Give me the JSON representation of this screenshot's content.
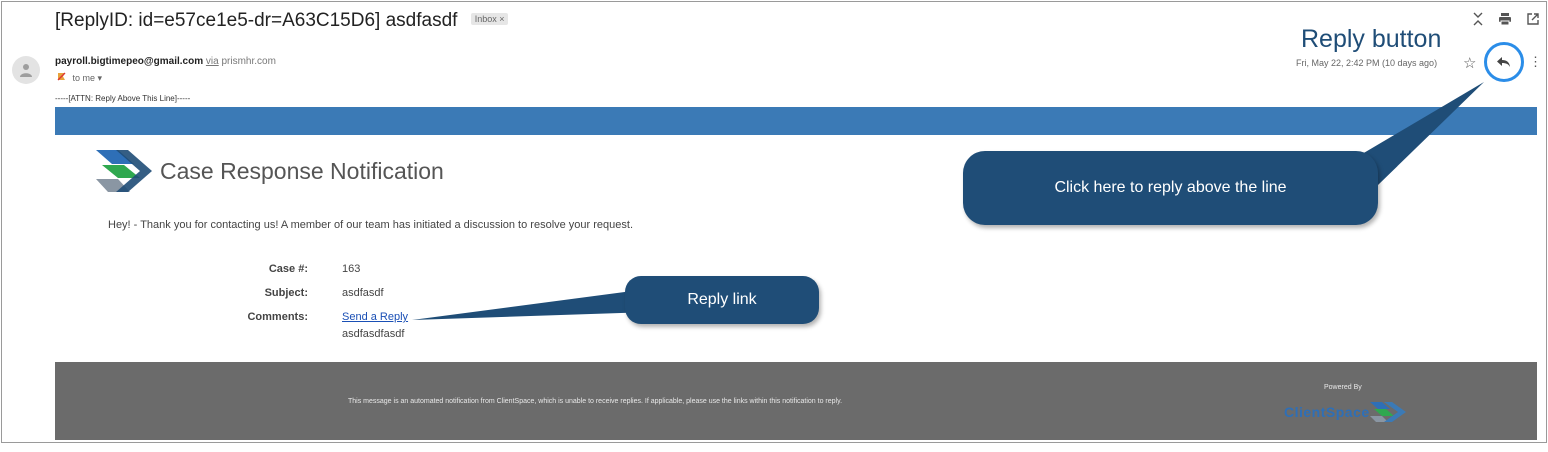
{
  "email": {
    "subject": "[ReplyID: id=e57ce1e5-dr=A63C15D6] asdfasdf",
    "label_badge": "Inbox ×",
    "sender_email": "payroll.bigtimepeo@gmail.com",
    "via_word": "via",
    "via_domain": "prismhr.com",
    "to_me": "to me ▾",
    "date": "Fri, May 22, 2:42 PM (10 days ago)",
    "attn_line": "-----[ATTN: Reply Above This Line]-----"
  },
  "notification": {
    "title": "Case Response Notification",
    "greeting": "Hey! - Thank you for contacting us! A member of our team has initiated a discussion to resolve your request.",
    "fields": {
      "case_label": "Case #:",
      "case_value": "163",
      "subject_label": "Subject:",
      "subject_value": "asdfasdf",
      "comments_label": "Comments:",
      "reply_link": "Send a Reply",
      "comments_value": "asdfasdfasdf"
    }
  },
  "footer": {
    "message": "This message is an automated notification from ClientSpace, which is unable to receive replies. If applicable, please use the links within this notification to reply.",
    "powered_by": "Powered By",
    "brand": "ClientSpace"
  },
  "annotations": {
    "reply_button_label": "Reply button",
    "callout_top": "Click here to reply above the line",
    "callout_link": "Reply link"
  },
  "icons": [
    "collapse-icon",
    "print-icon",
    "open-new-window-icon",
    "avatar-icon",
    "important-flag-icon",
    "star-icon",
    "reply-icon",
    "more-vert-icon"
  ],
  "colors": {
    "band_blue": "#3b7ab6",
    "callout_navy": "#1f4d77",
    "highlight_ring": "#2b8de8",
    "footer_gray": "#6b6b6b",
    "link_blue": "#1a4fb5"
  }
}
